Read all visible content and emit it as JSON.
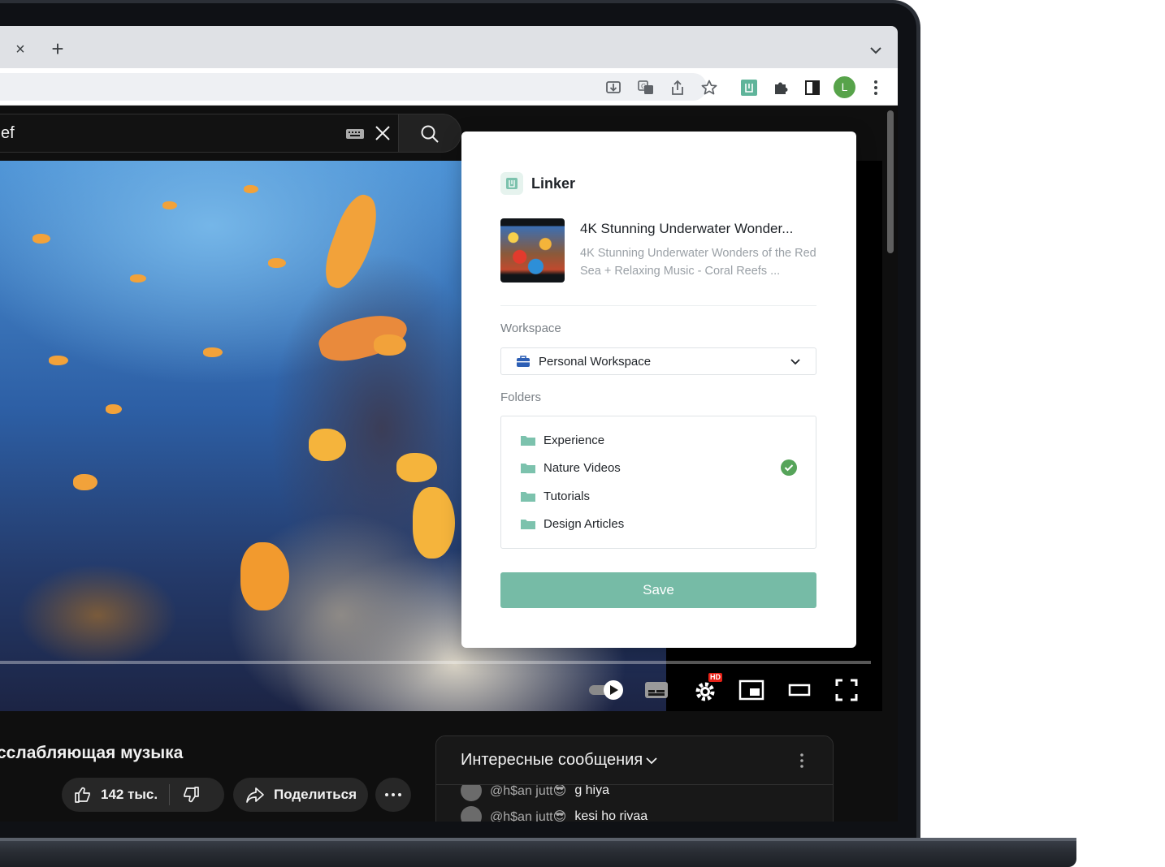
{
  "browser": {
    "tab_close_glyph": "×",
    "new_tab_glyph": "+",
    "profile_initial": "L"
  },
  "youtube": {
    "search_text": "ef",
    "video_title": "сслабляющая музыка",
    "likes": "142 тыс.",
    "share_label": "Поделиться",
    "chat": {
      "title": "Интересные сообщения",
      "messages": [
        {
          "user": "@h$an jutt😎",
          "text": "g hiya"
        },
        {
          "user": "@h$an jutt😎",
          "text": "kesi ho rivaa"
        }
      ]
    },
    "quality_badge": "HD"
  },
  "linker": {
    "brand": "Linker",
    "item": {
      "title": "4K Stunning Underwater Wonder...",
      "description": "4K Stunning Underwater Wonders of the Red Sea + Relaxing Music - Coral Reefs ..."
    },
    "workspace_label": "Workspace",
    "workspace_selected": "Personal Workspace",
    "folders_label": "Folders",
    "folders": [
      {
        "name": "Experience",
        "selected": false
      },
      {
        "name": "Nature Videos",
        "selected": true
      },
      {
        "name": "Tutorials",
        "selected": false
      },
      {
        "name": "Design Articles",
        "selected": false
      }
    ],
    "save_label": "Save",
    "accent_color": "#76bba6",
    "folder_color": "#7cc2ad",
    "check_color": "#56a45a"
  }
}
